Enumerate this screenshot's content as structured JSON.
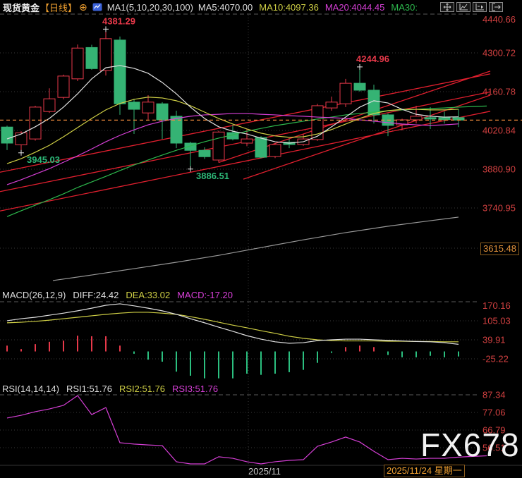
{
  "header": {
    "symbol": "现货黄金",
    "period": "【日线】",
    "period_toggle": "⊕",
    "ma_settings": "MA1(5,10,20,30,100)",
    "legend": [
      {
        "label": "MA5:4070.00",
        "color": "#e0e0e0"
      },
      {
        "label": "MA10:4097.36",
        "color": "#cfcf45"
      },
      {
        "label": "MA20:4044.45",
        "color": "#d63fd6"
      },
      {
        "label": "MA30:",
        "color": "#2db84d"
      }
    ],
    "toolbar_icons": [
      "move-icon",
      "scale-axes-icon",
      "playback-icon",
      "exit-right-icon"
    ]
  },
  "indicator_headers": {
    "macd": {
      "title": "MACD(26,12,9)",
      "items": [
        {
          "label": "DIFF:24.42",
          "color": "#e0e0e0"
        },
        {
          "label": "DEA:33.02",
          "color": "#cfcf45"
        },
        {
          "label": "MACD:-17.20",
          "color": "#d63fd6"
        }
      ]
    },
    "rsi": {
      "title": "RSI(14,14,14)",
      "items": [
        {
          "label": "RSI1:51.76",
          "color": "#e0e0e0"
        },
        {
          "label": "RSI2:51.76",
          "color": "#cfcf45"
        },
        {
          "label": "RSI3:51.76",
          "color": "#d63fd6"
        }
      ]
    }
  },
  "watermark": "FX678",
  "x_axis": {
    "month_label": "2025/11",
    "date_label": "2025/11/24 星期一"
  },
  "y_axis": {
    "main_labels": [
      "4440.66",
      "4300.72",
      "4160.78",
      "4020.84",
      "3880.90",
      "3740.95"
    ],
    "main_boxed_label": "3615.48",
    "macd_labels": [
      "170.16",
      "105.03",
      "39.91",
      "-25.22"
    ],
    "rsi_labels": [
      "87.34",
      "77.06",
      "66.79",
      "56.51"
    ]
  },
  "colors": {
    "background": "#000000",
    "axis_text": "#d04040",
    "up": "#e8394a",
    "down": "#35b374",
    "orange": "#f0a030",
    "last_price_line": "#f08c3c",
    "ma5": "#e0e0e0",
    "ma10": "#cfcf45",
    "ma20": "#d63fd6",
    "ma30": "#2db84d",
    "ma100": "#999999",
    "macd_hist_neg": "#2bbf7f",
    "trendline": "#e01f2e",
    "grid": "#3a3a3a",
    "grid_dash": "#5a5a5a",
    "marker": "#e8e8e8"
  },
  "chart_data": {
    "type": "candlestick",
    "symbol": "现货黄金",
    "timeframe": "日线",
    "legend_note": "red = up (hollow), green = down (filled), Chinese convention",
    "x_labels": [
      "2025/11",
      "2025/11/24 星期一"
    ],
    "main_pane": {
      "y_axis_ticks": [
        4440.66,
        4300.72,
        4160.78,
        4020.84,
        3880.9,
        3740.95,
        3615.48
      ],
      "last_price": 4058,
      "candles_ohlc": [
        [
          4033,
          4038,
          3950,
          3975
        ],
        [
          3969,
          4018,
          3945.03,
          4012
        ],
        [
          3990,
          4110,
          3984,
          4105
        ],
        [
          4089,
          4173,
          4084,
          4135
        ],
        [
          4140,
          4222,
          4133,
          4217
        ],
        [
          4207,
          4331,
          4199,
          4318
        ],
        [
          4320,
          4330,
          4240,
          4244
        ],
        [
          4237,
          4381.29,
          4219,
          4352
        ],
        [
          4347,
          4360,
          4077,
          4117
        ],
        [
          4123,
          4135,
          4008,
          4097
        ],
        [
          4084,
          4148,
          4060,
          4123
        ],
        [
          4117,
          4123,
          3990,
          4059
        ],
        [
          4072,
          4092,
          3957,
          3975
        ],
        [
          3975,
          3980,
          3886.51,
          3949
        ],
        [
          3949,
          3960,
          3918,
          3926
        ],
        [
          3914,
          4020,
          3905,
          4015
        ],
        [
          4013,
          4041,
          3985,
          3990
        ],
        [
          3975,
          4026,
          3964,
          3990
        ],
        [
          3995,
          4000,
          3920,
          3924
        ],
        [
          3927,
          3975,
          3921,
          3970
        ],
        [
          3978,
          3990,
          3957,
          3970
        ],
        [
          3970,
          4008,
          3965,
          3990
        ],
        [
          3988,
          4117,
          3983,
          4110
        ],
        [
          4102,
          4143,
          4092,
          4123
        ],
        [
          4117,
          4207,
          4105,
          4191
        ],
        [
          4191,
          4244.96,
          4161,
          4166
        ],
        [
          4166,
          4186,
          4046,
          4077
        ],
        [
          4077,
          4082,
          4000,
          4039
        ],
        [
          4041,
          4063,
          4021,
          4059
        ],
        [
          4059,
          4110,
          4046,
          4072
        ],
        [
          4067,
          4105,
          4026,
          4062
        ],
        [
          4067,
          4089,
          4046,
          4060
        ],
        [
          4067,
          4097,
          4033,
          4058
        ]
      ],
      "annotations": [
        {
          "index": 7,
          "text": "4381.29",
          "placement": "above",
          "color": "#e8394a"
        },
        {
          "index": 1,
          "text": "3945.03",
          "placement": "below",
          "color": "#2db878"
        },
        {
          "index": 25,
          "text": "4244.96",
          "placement": "above",
          "color": "#e8394a"
        },
        {
          "index": 13,
          "text": "3886.51",
          "placement": "below",
          "color": "#2db878"
        }
      ],
      "ma5": [
        3990,
        4008,
        4034,
        4064,
        4105,
        4153,
        4207,
        4247,
        4255,
        4245,
        4227,
        4194,
        4153,
        4105,
        4064,
        4034,
        4018,
        4008,
        3993,
        3980,
        3975,
        3980,
        4000,
        4034,
        4069,
        4105,
        4128,
        4120,
        4097,
        4079,
        4072,
        4069,
        4070
      ],
      "ma10": [
        3901,
        3919,
        3942,
        3967,
        3998,
        4031,
        4064,
        4095,
        4118,
        4133,
        4141,
        4138,
        4128,
        4110,
        4087,
        4064,
        4044,
        4026,
        4011,
        4001,
        3996,
        3998,
        4008,
        4024,
        4044,
        4064,
        4082,
        4092,
        4097,
        4097,
        4095,
        4095,
        4097.36
      ],
      "ma20": [
        3825,
        3843,
        3863,
        3883,
        3906,
        3929,
        3954,
        3980,
        4003,
        4023,
        4041,
        4054,
        4064,
        4072,
        4077,
        4079,
        4082,
        4082,
        4079,
        4077,
        4074,
        4072,
        4069,
        4067,
        4064,
        4059,
        4054,
        4049,
        4044,
        4041,
        4039,
        4041,
        4044.45
      ],
      "ma30": [
        3710,
        3731,
        3751,
        3771,
        3792,
        3815,
        3835,
        3855,
        3876,
        3896,
        3914,
        3932,
        3949,
        3965,
        3980,
        3993,
        4005,
        4018,
        4028,
        4038,
        4046,
        4054,
        4062,
        4069,
        4077,
        4082,
        4087,
        4092,
        4095,
        4097,
        4100,
        4102,
        4105,
        4107,
        4109
      ],
      "ma100_x_price": [
        [
          75,
          3479
        ],
        [
          130,
          3499
        ],
        [
          190,
          3522
        ],
        [
          250,
          3545
        ],
        [
          310,
          3570
        ],
        [
          370,
          3598
        ],
        [
          430,
          3626
        ],
        [
          490,
          3652
        ],
        [
          550,
          3675
        ],
        [
          610,
          3695
        ],
        [
          650,
          3708
        ]
      ],
      "trendlines_x_price": [
        [
          0,
          3870,
          695,
          4225
        ],
        [
          0,
          3800,
          695,
          4160
        ],
        [
          0,
          3730,
          695,
          4090
        ],
        [
          310,
          3905,
          695,
          4235
        ],
        [
          345,
          3845,
          695,
          4148
        ]
      ]
    },
    "macd_pane": {
      "params": "(26,12,9)",
      "diff": 24.42,
      "dea": 33.02,
      "macd": -17.2,
      "y_axis_ticks": [
        170.16,
        105.03,
        39.91,
        -25.22
      ],
      "hist_values": [
        20,
        8,
        25,
        33,
        37,
        54,
        52,
        52,
        20,
        -8,
        -28,
        -35,
        -69,
        -83,
        -92,
        -92,
        -92,
        -76,
        -80,
        -76,
        -71,
        -63,
        -39,
        -5,
        15,
        20,
        15,
        -12,
        -20,
        -20,
        -15,
        -20,
        -17.2
      ],
      "diff_line": [
        105,
        112,
        117,
        124,
        131,
        139,
        148,
        158,
        163,
        156,
        148,
        139,
        127,
        112,
        98,
        83,
        69,
        54,
        42,
        33,
        28,
        30,
        37,
        40,
        42,
        42,
        40,
        38,
        36,
        34,
        33,
        30,
        24.42
      ],
      "dea_line": [
        98,
        100,
        103,
        107,
        112,
        117,
        122,
        127,
        131,
        134,
        134,
        131,
        127,
        119,
        110,
        100,
        90,
        81,
        71,
        62,
        52,
        45,
        40,
        37,
        36,
        36,
        36,
        35,
        35,
        34,
        34,
        33,
        33.02
      ]
    },
    "rsi_pane": {
      "params": "(14,14,14)",
      "rsi1": 51.76,
      "rsi2": 51.76,
      "rsi3": 51.76,
      "y_axis_ticks": [
        87.34,
        77.06,
        66.79,
        56.51
      ],
      "rsi_line": [
        73.8,
        75.4,
        77.5,
        79.1,
        81.2,
        86.9,
        75.8,
        79.9,
        59.4,
        58.6,
        58.1,
        57.7,
        48.3,
        47,
        45.8,
        51.2,
        50.3,
        48.3,
        45.4,
        48.3,
        49.1,
        49.5,
        57.3,
        59.8,
        62.7,
        59.8,
        54.4,
        49.5,
        50.3,
        49.9,
        50.3,
        50.3,
        51,
        51.4,
        51.76
      ]
    }
  }
}
